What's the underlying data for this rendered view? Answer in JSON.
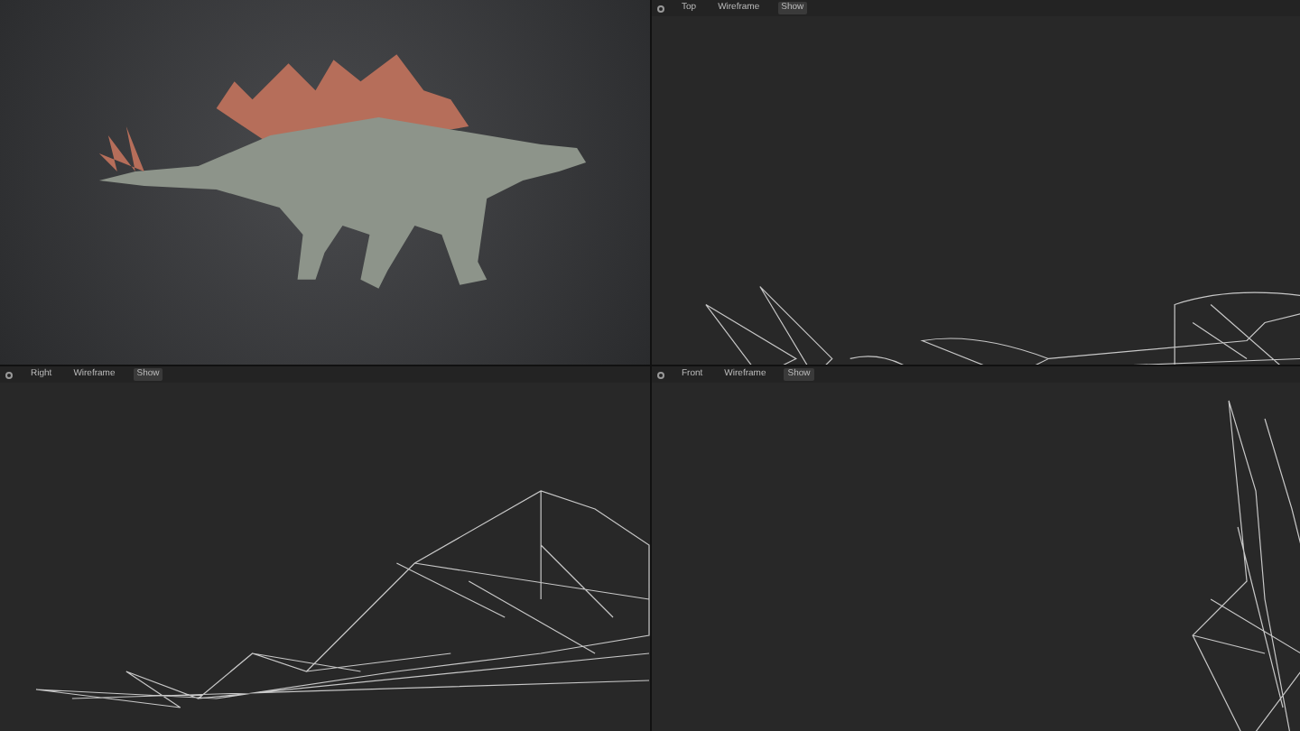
{
  "viewports": [
    {
      "kind": "render"
    },
    {
      "kind": "wireframe",
      "view": "Top",
      "shading": "Wireframe",
      "overlay": "Show"
    },
    {
      "kind": "wireframe",
      "view": "Right",
      "shading": "Wireframe",
      "overlay": "Show"
    },
    {
      "kind": "wireframe",
      "view": "Front",
      "shading": "Wireframe",
      "overlay": "Show"
    }
  ]
}
